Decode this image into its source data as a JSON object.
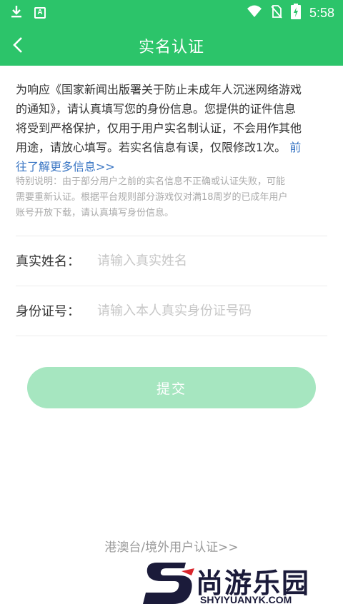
{
  "status_bar": {
    "time": "5:58",
    "app_badge": "A",
    "icons": [
      "download-icon",
      "app-badge-icon",
      "wifi-icon",
      "no-sim-icon",
      "battery-charging-icon"
    ]
  },
  "nav": {
    "title": "实名认证",
    "back_icon": "chevron-left-icon"
  },
  "notice": {
    "line1": "为响应《国家新闻出版署关于防止未成年人沉迷网络游戏",
    "line2": "的通知》，请认真填写您的身份信息。您提供的证件信息",
    "line3": "将受到严格保护，仅用于用户实名制认证，不会用作其他",
    "line4_text": "用途，请放心填写。若实名信息有误，仅限修改1次。",
    "line4_link": "前",
    "line5_link": "往了解更多信息>>"
  },
  "special_note": {
    "line1": "特别说明：由于部分用户之前的实名信息不正确或认证失败，可能",
    "line2": "需要重新认证。根据平台规则部分游戏仅对满18周岁的已成年用户",
    "line3": "账号开放下载，请认真填写身份信息。"
  },
  "form": {
    "name_label": "真实姓名：",
    "name_placeholder": "请输入真实姓名",
    "name_value": "",
    "id_label": "身份证号：",
    "id_placeholder": "请输入本人真实身份证号码",
    "id_value": ""
  },
  "submit_label": "提交",
  "hk_link": "港澳台/境外用户认证>>",
  "watermark": {
    "text": "尚游乐园",
    "url": "SHYIYUANYK.COM"
  },
  "colors": {
    "brand_green": "#2cc46a",
    "button_disabled": "#a6e6c0",
    "link_blue": "#3a76c4"
  }
}
